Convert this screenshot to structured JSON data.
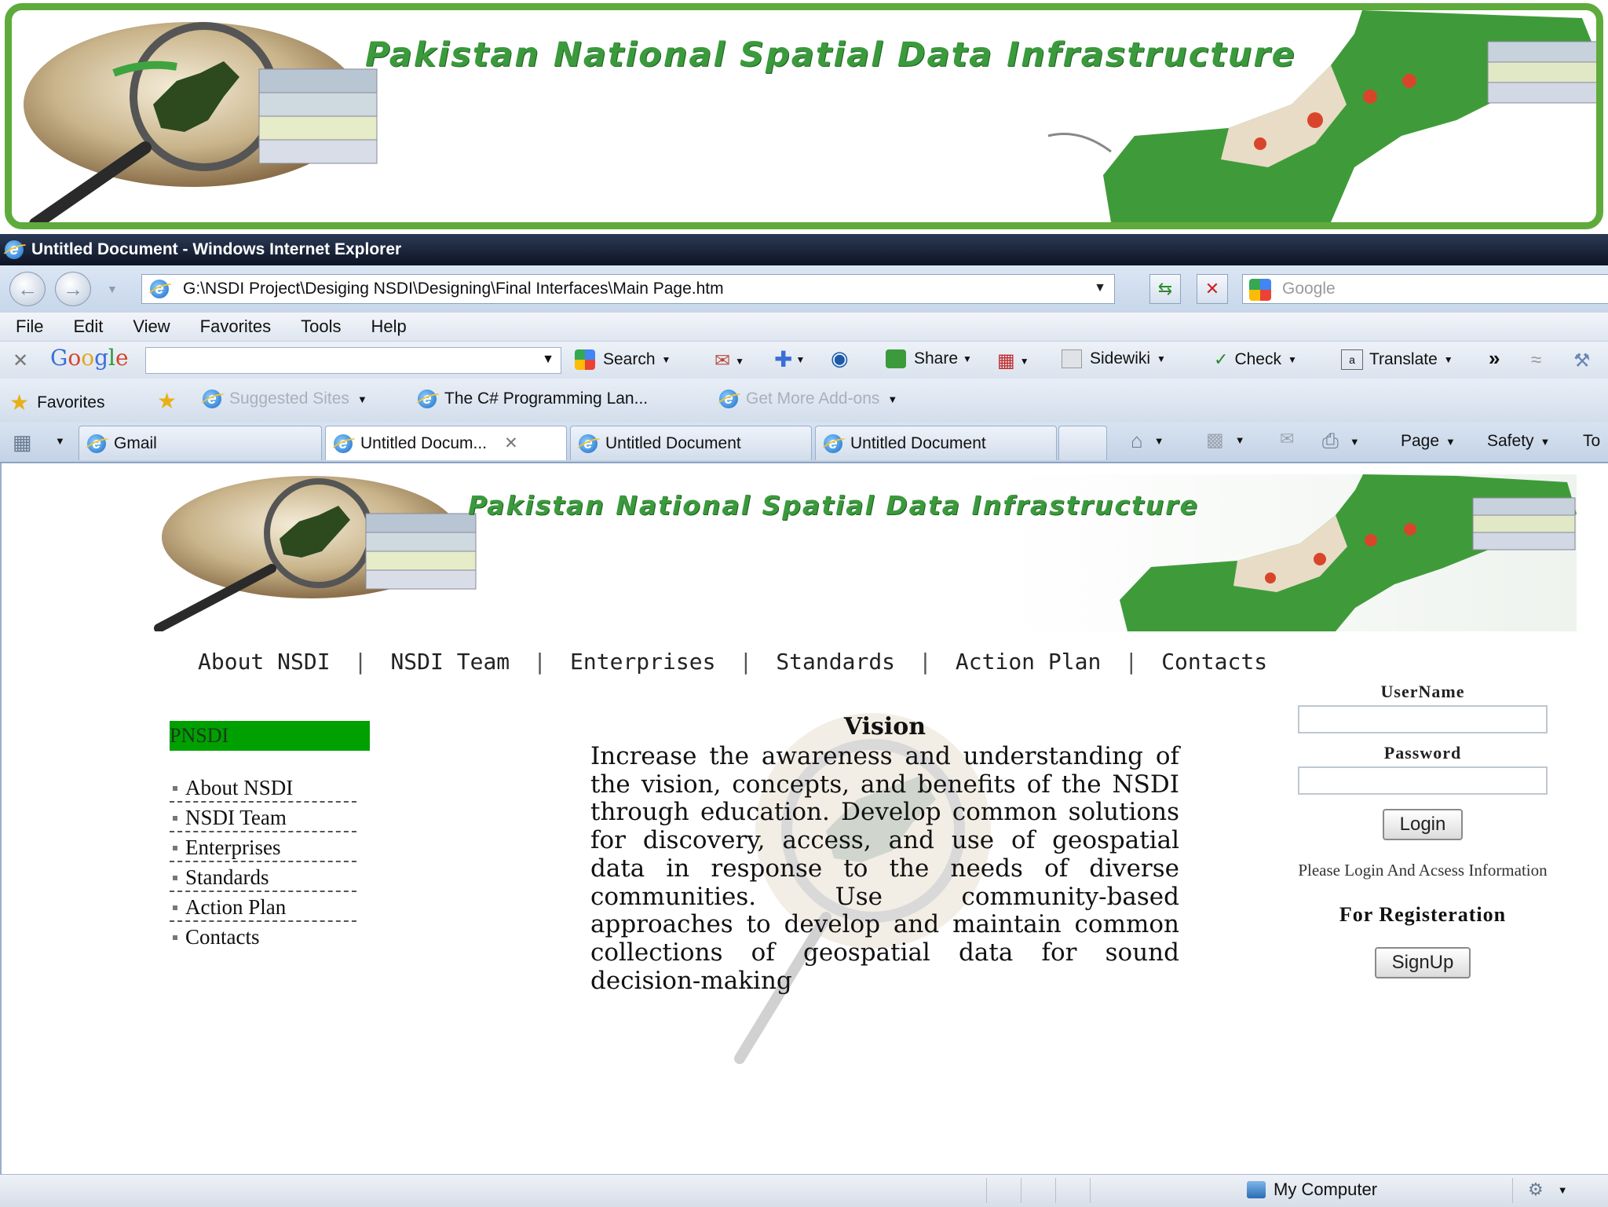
{
  "banner": {
    "title": "Pakistan National Spatial Data Infrastructure"
  },
  "window": {
    "title": "Untitled Document - Windows Internet Explorer"
  },
  "address": {
    "url": "G:\\NSDI Project\\Desiging NSDI\\Designing\\Final Interfaces\\Main Page.htm",
    "search_placeholder": "Google"
  },
  "menu": [
    "File",
    "Edit",
    "View",
    "Favorites",
    "Tools",
    "Help"
  ],
  "googlebar": {
    "logo": "Google",
    "search": "Search",
    "share": "Share",
    "sidewiki": "Sidewiki",
    "check": "Check",
    "translate": "Translate",
    "more": "»"
  },
  "favorites": {
    "label": "Favorites",
    "items": [
      "Suggested Sites",
      "The C# Programming Lan...",
      "Get More Add-ons"
    ]
  },
  "tabs": {
    "items": [
      "Gmail",
      "Untitled Docum...",
      "Untitled Document",
      "Untitled Document"
    ],
    "commands": {
      "page": "Page",
      "safety": "Safety",
      "tools": "To"
    }
  },
  "page": {
    "banner_title": "Pakistan National Spatial Data Infrastructure",
    "nav": [
      "About NSDI",
      "NSDI Team",
      "Enterprises",
      "Standards",
      "Action Plan",
      "Contacts"
    ],
    "sidebar": {
      "header": "PNSDI",
      "items": [
        "About NSDI",
        "NSDI Team",
        "Enterprises",
        "Standards",
        "Action Plan",
        "Contacts"
      ]
    },
    "vision": {
      "title": "Vision",
      "text": "Increase the awareness and understanding of the vision, concepts, and benefits of the NSDI through education. Develop common solutions for discovery, access, and use of geospatial data in response to the needs of diverse communities. Use community-based approaches to develop and maintain common collections of geospatial data for sound decision-making"
    },
    "login": {
      "username_label": "UserName",
      "password_label": "Password",
      "login_button": "Login",
      "note": "Please Login And Acsess Information",
      "registration_title": "For Registeration",
      "signup_button": "SignUp"
    }
  },
  "status": {
    "zone": "My Computer"
  },
  "colors": {
    "accent_green": "#00a000",
    "banner_border": "#5faa3c",
    "title_green": "#3a9a3c"
  }
}
